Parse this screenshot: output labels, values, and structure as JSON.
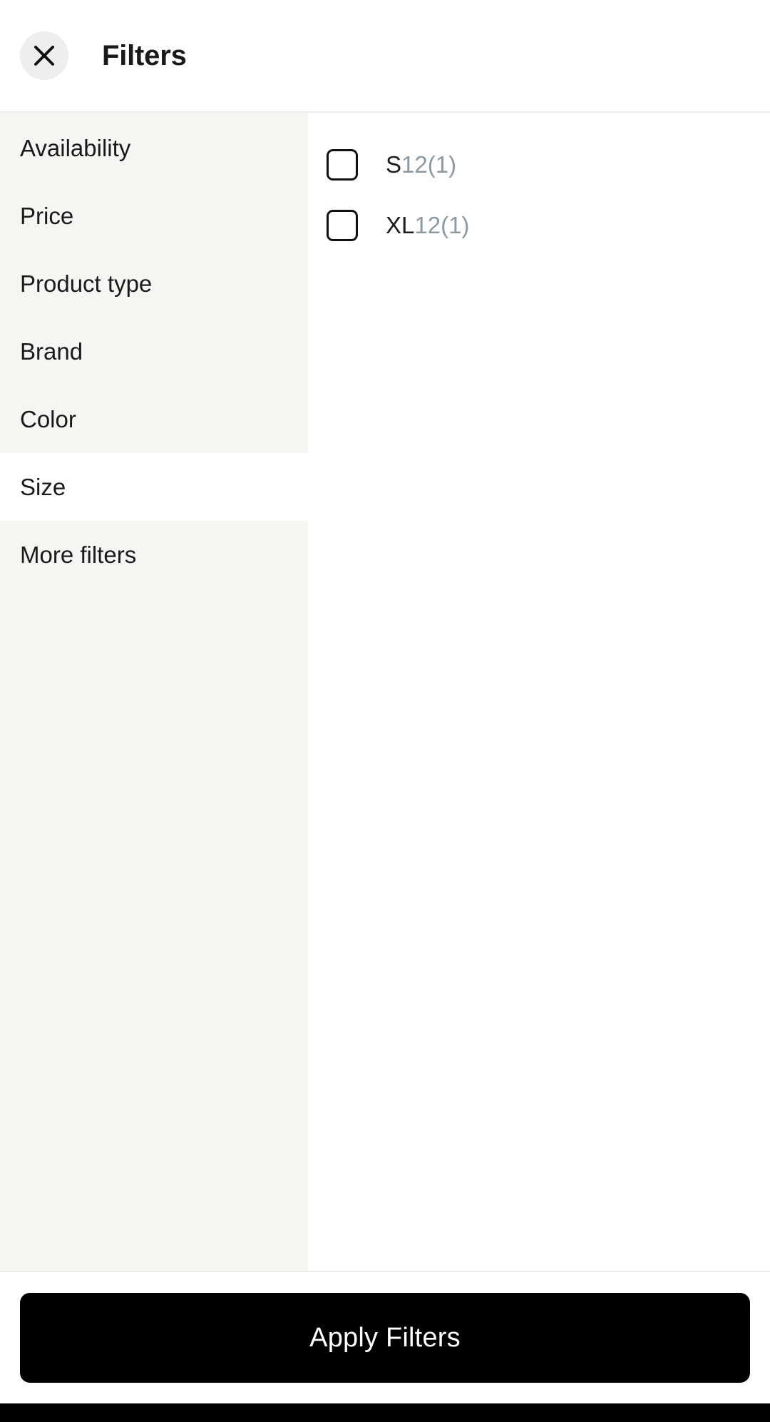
{
  "header": {
    "title": "Filters",
    "close_icon": "close-icon"
  },
  "sidebar": {
    "items": [
      {
        "label": "Availability",
        "active": false
      },
      {
        "label": "Price",
        "active": false
      },
      {
        "label": "Product type",
        "active": false
      },
      {
        "label": "Brand",
        "active": false
      },
      {
        "label": "Color",
        "active": false
      },
      {
        "label": "Size",
        "active": true
      },
      {
        "label": "More filters",
        "active": false
      }
    ]
  },
  "options": {
    "items": [
      {
        "label": "S",
        "count": "12(1)",
        "checked": false
      },
      {
        "label": "XL",
        "count": "12(1)",
        "checked": false
      }
    ]
  },
  "footer": {
    "apply_label": "Apply Filters"
  },
  "colors": {
    "sidebar_bg": "#f5f5f2",
    "panel_bg": "#ffffff",
    "text": "#1a1a1a",
    "count_text": "#8e9aa3",
    "button_bg": "#000000",
    "button_text": "#ffffff",
    "divider": "#ececec",
    "close_circle_bg": "#eeeeee"
  }
}
